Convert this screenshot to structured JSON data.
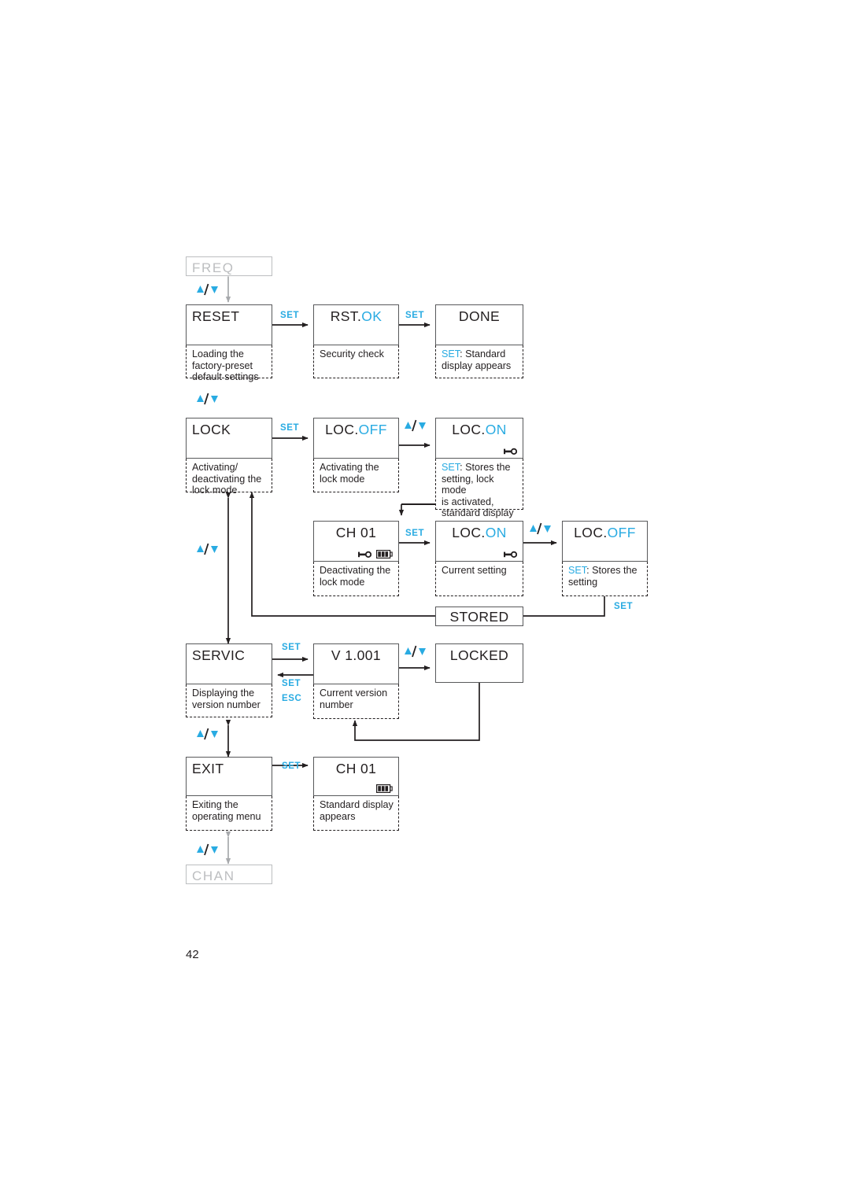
{
  "page": {
    "number": "42"
  },
  "colors": {
    "accent": "#29abe2",
    "ink": "#231f20",
    "line": "#58595b",
    "ghost": "#bcbec0"
  },
  "menu_top": {
    "label": "FREQ"
  },
  "menu_bottom": {
    "label": "CHAN"
  },
  "keys": {
    "set": "SET",
    "esc": "ESC",
    "updown": "▲/▼"
  },
  "rows": [
    {
      "id": "reset",
      "screens": [
        {
          "name": "reset",
          "text_plain": "RESET",
          "text_blue": "",
          "align": "left",
          "icons": [],
          "caption": "Loading the\nfactory-preset\ndefault settings",
          "caption_key": ""
        },
        {
          "name": "rst-ok",
          "text_plain": "RST.",
          "text_blue": "OK",
          "align": "center",
          "icons": [],
          "caption": "Security check",
          "caption_key": ""
        },
        {
          "name": "done",
          "text_plain": "DONE",
          "text_blue": "",
          "align": "center",
          "icons": [],
          "caption": ": Standard\ndisplay appears",
          "caption_key": "SET"
        }
      ],
      "transitions": [
        "SET",
        "SET"
      ]
    },
    {
      "id": "lock",
      "screens": [
        {
          "name": "lock",
          "text_plain": "LOCK",
          "text_blue": "",
          "align": "left",
          "icons": [],
          "caption": "Activating/\ndeactivating the\nlock mode",
          "caption_key": ""
        },
        {
          "name": "loc-off",
          "text_plain": "LOC.",
          "text_blue": "OFF",
          "align": "center",
          "icons": [],
          "caption": "Activating the\nlock mode",
          "caption_key": ""
        },
        {
          "name": "loc-on",
          "text_plain": "LOC.",
          "text_blue": "ON",
          "align": "center",
          "icons": [
            "key-icon"
          ],
          "caption": ": Stores the\nsetting, lock mode\nis activated,\nstandard display\nappears",
          "caption_key": "SET"
        }
      ],
      "transitions": [
        "SET",
        "▲/▼"
      ]
    },
    {
      "id": "unlock",
      "screens": [
        {
          "name": "ch-01-locked",
          "text_plain": "CH  01",
          "text_blue": "",
          "align": "center",
          "icons": [
            "key-icon",
            "battery-icon"
          ],
          "caption": "Deactivating the\nlock mode",
          "caption_key": ""
        },
        {
          "name": "loc-on-current",
          "text_plain": "LOC.",
          "text_blue": "ON",
          "align": "center",
          "icons": [
            "key-icon"
          ],
          "caption": "Current setting",
          "caption_key": ""
        },
        {
          "name": "loc-off-store",
          "text_plain": "LOC.",
          "text_blue": "OFF",
          "align": "center",
          "icons": [],
          "caption": ": Stores the\nsetting",
          "caption_key": "SET"
        }
      ],
      "transitions": [
        "SET",
        "▲/▼"
      ]
    },
    {
      "id": "servic",
      "screens": [
        {
          "name": "servic",
          "text_plain": "SERVIC",
          "text_blue": "",
          "align": "left",
          "icons": [],
          "caption": "Displaying the\nversion number",
          "caption_key": ""
        },
        {
          "name": "version",
          "text_plain": "V 1.001",
          "text_blue": "",
          "align": "center",
          "icons": [],
          "caption": "Current version\nnumber",
          "caption_key": ""
        },
        {
          "name": "locked",
          "text_plain": "LOCKED",
          "text_blue": "",
          "align": "center",
          "icons": [],
          "caption": "",
          "caption_key": ""
        }
      ],
      "transitions": [
        "SET",
        "▲/▼"
      ]
    },
    {
      "id": "exit",
      "screens": [
        {
          "name": "exit",
          "text_plain": "EXIT",
          "text_blue": "",
          "align": "left",
          "icons": [],
          "caption": "Exiting the\noperating menu",
          "caption_key": ""
        },
        {
          "name": "ch-01-standard",
          "text_plain": "CH  01",
          "text_blue": "",
          "align": "center",
          "icons": [
            "battery-icon"
          ],
          "caption": "Standard display\nappears",
          "caption_key": ""
        }
      ],
      "transitions": [
        "SET"
      ]
    }
  ],
  "stored": {
    "label": "STORED",
    "key": "SET"
  },
  "servic_back_keys": {
    "top": "SET",
    "mid": "SET",
    "bottom": "ESC"
  }
}
